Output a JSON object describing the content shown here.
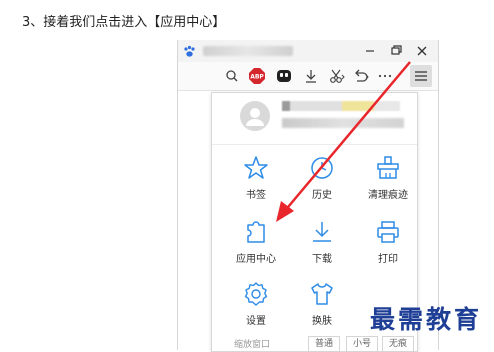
{
  "step_text": "3、接着我们点击进入【应用中心】",
  "menu": {
    "items": [
      {
        "label": "书签",
        "icon": "star-icon"
      },
      {
        "label": "历史",
        "icon": "clock-icon"
      },
      {
        "label": "清理痕迹",
        "icon": "broom-icon"
      },
      {
        "label": "应用中心",
        "icon": "puzzle-icon"
      },
      {
        "label": "下载",
        "icon": "download-icon"
      },
      {
        "label": "打印",
        "icon": "printer-icon"
      },
      {
        "label": "设置",
        "icon": "gear-icon"
      },
      {
        "label": "换肤",
        "icon": "tshirt-icon"
      }
    ],
    "bottom_left": "缩放窗口",
    "zoom_options": [
      "普通",
      "小号",
      "无痕"
    ]
  },
  "watermark": "最需教育",
  "colors": {
    "accent": "#2f8ce6",
    "arrow": "#e8262c",
    "watermark": "#1f3f96"
  }
}
